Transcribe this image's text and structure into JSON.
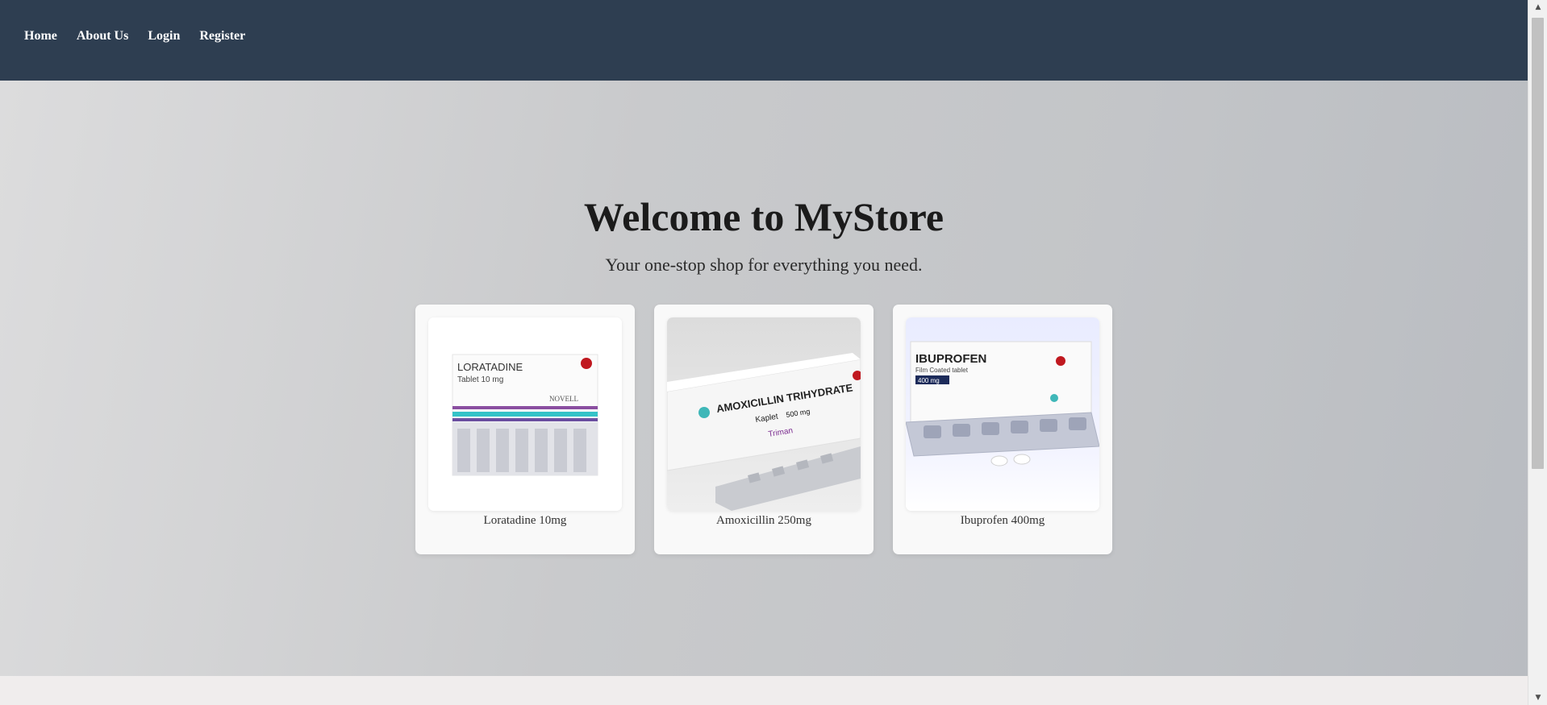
{
  "nav": {
    "items": [
      {
        "label": "Home"
      },
      {
        "label": "About Us"
      },
      {
        "label": "Login"
      },
      {
        "label": "Register"
      }
    ]
  },
  "hero": {
    "title": "Welcome to MyStore",
    "subtitle": "Your one-stop shop for everything you need."
  },
  "products": [
    {
      "name": "Loratadine 10mg",
      "package_lines": [
        "LORATADINE",
        "Tablet 10 mg",
        "NOVELL"
      ]
    },
    {
      "name": "Amoxicillin 250mg",
      "package_lines": [
        "AMOXICILLIN TRIHYDRATE",
        "Kaplet",
        "500 mg",
        "Triman"
      ]
    },
    {
      "name": "Ibuprofen 400mg",
      "package_lines": [
        "IBUPROFEN",
        "Film Coated tablet",
        "400 mg"
      ]
    }
  ],
  "colors": {
    "navbar": "#2e3e51",
    "nav_text": "#ffffff",
    "card_bg": "#f9f9f9"
  },
  "scrollbar": {
    "up_icon": "scroll-up-arrow",
    "down_icon": "scroll-down-arrow"
  }
}
